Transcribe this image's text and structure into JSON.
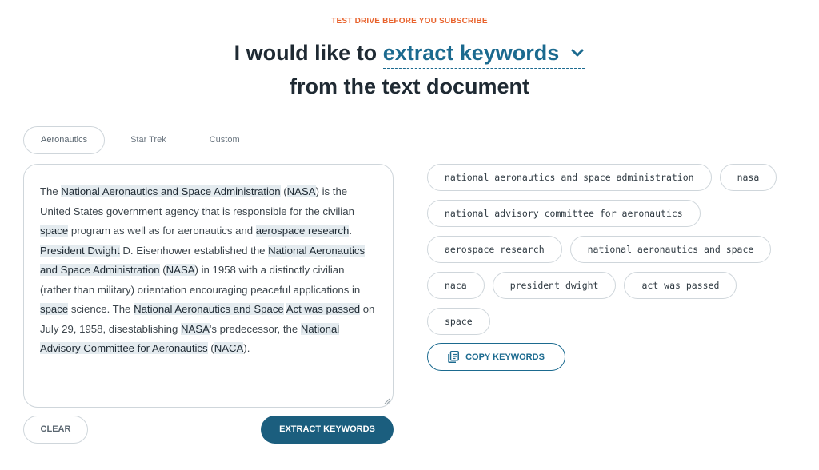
{
  "eyebrow": "TEST DRIVE BEFORE YOU SUBSCRIBE",
  "headline": {
    "prefix": "I would like to",
    "action": "extract keywords",
    "suffix": "from the text document"
  },
  "tabs": [
    {
      "label": "Aeronautics",
      "active": true
    },
    {
      "label": "Star Trek",
      "active": false
    },
    {
      "label": "Custom",
      "active": false
    }
  ],
  "editor": {
    "segments": [
      {
        "t": "The ",
        "h": false
      },
      {
        "t": "National Aeronautics and Space Administration",
        "h": true
      },
      {
        "t": " (",
        "h": false
      },
      {
        "t": "NASA",
        "h": true
      },
      {
        "t": ") is the United States government agency that is responsible for the civilian ",
        "h": false
      },
      {
        "t": "space",
        "h": true
      },
      {
        "t": " program as well as for aeronautics and ",
        "h": false
      },
      {
        "t": "aerospace research",
        "h": true
      },
      {
        "t": ". ",
        "h": false
      },
      {
        "t": "President Dwight",
        "h": true
      },
      {
        "t": " D. Eisenhower established the ",
        "h": false
      },
      {
        "t": "National Aeronautics and Space Administration",
        "h": true
      },
      {
        "t": " (",
        "h": false
      },
      {
        "t": "NASA",
        "h": true
      },
      {
        "t": ") in 1958 with a distinctly civilian (rather than military) orientation encouraging peaceful applications in ",
        "h": false
      },
      {
        "t": "space",
        "h": true
      },
      {
        "t": " science. The ",
        "h": false
      },
      {
        "t": "National Aeronautics and Space",
        "h": true
      },
      {
        "t": " ",
        "h": false
      },
      {
        "t": "Act was passed",
        "h": true
      },
      {
        "t": " on July 29, 1958, disestablishing ",
        "h": false
      },
      {
        "t": "NASA",
        "h": true
      },
      {
        "t": "'s predecessor, the ",
        "h": false
      },
      {
        "t": "National Advisory Committee for Aeronautics",
        "h": true
      },
      {
        "t": " (",
        "h": false
      },
      {
        "t": "NACA",
        "h": true
      },
      {
        "t": ").",
        "h": false
      }
    ]
  },
  "buttons": {
    "clear": "CLEAR",
    "extract": "EXTRACT KEYWORDS",
    "copy": "COPY KEYWORDS"
  },
  "keywords": [
    [
      "national aeronautics and space administration",
      "nasa"
    ],
    [
      "national advisory committee for aeronautics"
    ],
    [
      "aerospace research",
      "national aeronautics and space"
    ],
    [
      "naca",
      "president dwight",
      "act was passed"
    ],
    [
      "space"
    ]
  ],
  "icons": {
    "dropdown": "chevron-down-icon",
    "copy": "copy-document-icon"
  },
  "colors": {
    "accent": "#1b6a8f",
    "eyebrow": "#e8622c",
    "primary_button": "#1b5e7e",
    "highlight": "#e4ebef"
  }
}
